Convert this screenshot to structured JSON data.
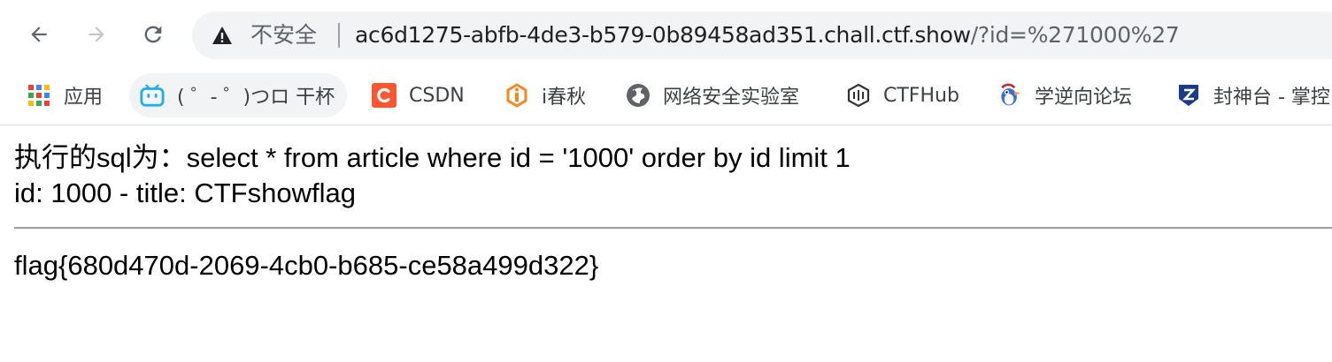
{
  "browser": {
    "url_host": "ac6d1275-abfb-4de3-b579-0b89458ad351.chall.ctf.show",
    "url_path": "/?id=%271000%27",
    "security_label": "不安全",
    "icons": {
      "back": "arrow-left-icon",
      "forward": "arrow-right-icon",
      "reload": "reload-icon",
      "security": "warning-triangle-icon"
    }
  },
  "bookmarks": [
    {
      "label": "应用",
      "icon": "apps-grid-icon"
    },
    {
      "label": "( ゜- ゜)つロ 干杯",
      "icon": "bilibili-icon"
    },
    {
      "label": "CSDN",
      "icon": "csdn-icon",
      "color": "#fc5531"
    },
    {
      "label": "i春秋",
      "icon": "ichunqiu-icon",
      "color": "#f08a24"
    },
    {
      "label": "网络安全实验室",
      "icon": "globe-icon"
    },
    {
      "label": "CTFHub",
      "icon": "ctfhub-icon"
    },
    {
      "label": "学逆向论坛",
      "icon": "bird-icon"
    },
    {
      "label": "封神台 - 掌控",
      "icon": "fengshentai-icon",
      "color": "#1a3a8a"
    }
  ],
  "page": {
    "sql_line": "执行的sql为：select * from article where id = '1000' order by id limit 1",
    "result_line": "id: 1000 - title: CTFshowflag",
    "flag_line": "flag{680d470d-2069-4cb0-b685-ce58a499d322}"
  }
}
